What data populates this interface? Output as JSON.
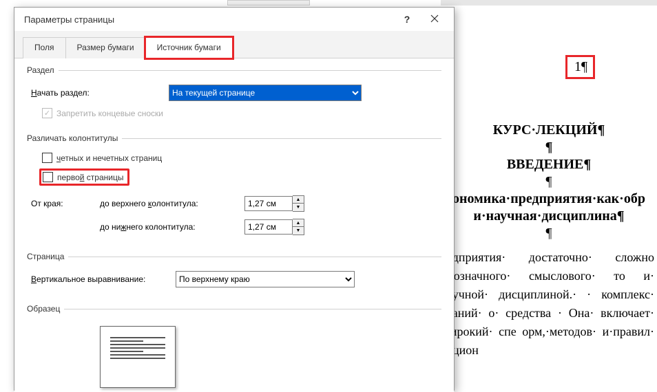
{
  "dialog": {
    "title": "Параметры страницы",
    "tabs": {
      "fields": "Поля",
      "paper_size": "Размер бумаги",
      "paper_source": "Источник бумаги"
    },
    "section": {
      "legend": "Раздел",
      "start_label_pre": "Н",
      "start_label_post": "ачать раздел:",
      "start_value": "На текущей странице",
      "suppress_endnotes": "Запретить концевые сноски"
    },
    "headers": {
      "legend": "Различать колонтитулы",
      "odd_even_pre": "ч",
      "odd_even_post": "етных и нечетных страниц",
      "first_page_pre": "перво",
      "first_page_u": "й",
      "first_page_post": " страницы",
      "from_edge": "От края:",
      "to_header_pre": "до верхнего ",
      "to_header_u": "к",
      "to_header_post": "олонтитула:",
      "to_footer_pre": "до ни",
      "to_footer_u": "ж",
      "to_footer_post": "него колонтитула:",
      "header_dist": "1,27 см",
      "footer_dist": "1,27 см"
    },
    "page": {
      "legend": "Страница",
      "valign_label_pre": "В",
      "valign_label_post": "ертикальное выравнивание:",
      "valign_value": "По верхнему краю"
    },
    "preview": {
      "legend": "Образец"
    }
  },
  "doc": {
    "page_number": "1¶",
    "lines": [
      "КУРС·ЛЕКЦИЙ¶",
      "¶",
      "ВВЕДЕНИЕ¶",
      "¶",
      "ономика·предприятия·как·обр",
      "и·научная·дисциплина¶",
      "¶"
    ],
    "body": "редприятия· достаточно· сложно днозначного· смыслового· то и· научной· дисциплиной.· · комплекс· знаний· о· средства · Она· включает· широкий· спе орм,·методов· и·правил· рацион"
  }
}
